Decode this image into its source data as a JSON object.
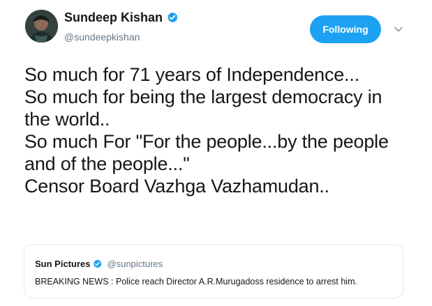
{
  "tweet": {
    "author": {
      "display_name": "Sundeep Kishan",
      "handle": "@sundeepkishan",
      "verified": true,
      "avatar_icon": "profile-photo"
    },
    "follow_button_label": "Following",
    "menu_icon": "chevron-down-icon",
    "text_lines": [
      "So much for 71 years of Independence...",
      "So much for being the largest democracy in",
      "the world..",
      "So much For \"For the people...by the people",
      "and of the people...\"",
      "Censor Board Vazhga Vazhamudan.."
    ],
    "quoted_tweet": {
      "display_name": "Sun Pictures",
      "handle": "@sunpictures",
      "verified": true,
      "text": "BREAKING NEWS : Police reach Director A.R.Murugadoss residence to arrest him."
    }
  },
  "colors": {
    "accent": "#1da1f2",
    "text_primary": "#14171a",
    "text_secondary": "#657786",
    "border": "#e1e8ed"
  }
}
